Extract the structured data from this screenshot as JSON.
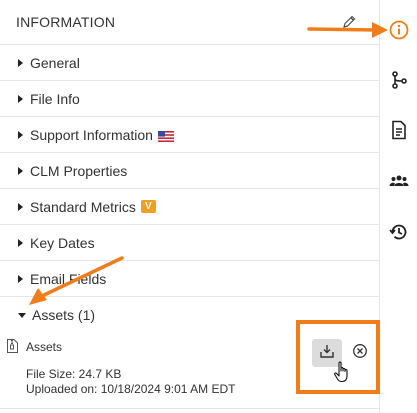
{
  "panel": {
    "title": "INFORMATION",
    "sections": [
      {
        "label": "General",
        "expanded": false
      },
      {
        "label": "File Info",
        "expanded": false
      },
      {
        "label": "Support Information",
        "expanded": false,
        "suffix_icon": "us-flag-icon"
      },
      {
        "label": "CLM Properties",
        "expanded": false
      },
      {
        "label": "Standard Metrics",
        "expanded": false,
        "suffix_icon": "v-badge-icon"
      },
      {
        "label": "Key Dates",
        "expanded": false
      },
      {
        "label": "Email Fields",
        "expanded": false
      },
      {
        "label": "Assets (1)",
        "expanded": true
      }
    ],
    "asset": {
      "name": "Assets",
      "file_size": "File Size: 24.7 KB",
      "uploaded_on": "Uploaded on: 10/18/2024 9:01 AM EDT",
      "icon": "zip-file-icon"
    },
    "badge_v_text": "V"
  },
  "rail": {
    "icons": [
      "info-icon",
      "branch-icon",
      "document-icon",
      "people-icon",
      "history-icon"
    ],
    "active": "info-icon"
  },
  "colors": {
    "accent_orange": "#f07d1a",
    "border": "#e4e4e4",
    "text": "#333333",
    "download_bg": "#dcdcdc"
  }
}
